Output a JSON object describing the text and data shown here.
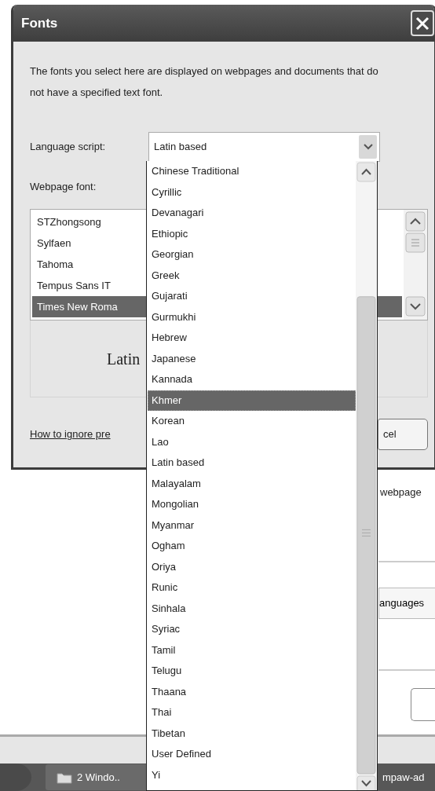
{
  "dialog": {
    "title": "Fonts",
    "description": "The fonts you select here are displayed on webpages and documents that do not have a specified text font.",
    "language_script": {
      "label": "Language script:",
      "value": "Latin based",
      "options": [
        {
          "label": "Chinese Traditional",
          "highlighted": false
        },
        {
          "label": "Cyrillic",
          "highlighted": false
        },
        {
          "label": "Devanagari",
          "highlighted": false
        },
        {
          "label": "Ethiopic",
          "highlighted": false
        },
        {
          "label": "Georgian",
          "highlighted": false
        },
        {
          "label": "Greek",
          "highlighted": false
        },
        {
          "label": "Gujarati",
          "highlighted": false
        },
        {
          "label": "Gurmukhi",
          "highlighted": false
        },
        {
          "label": "Hebrew",
          "highlighted": false
        },
        {
          "label": "Japanese",
          "highlighted": false
        },
        {
          "label": "Kannada",
          "highlighted": false
        },
        {
          "label": "Khmer",
          "highlighted": true
        },
        {
          "label": "Korean",
          "highlighted": false
        },
        {
          "label": "Lao",
          "highlighted": false
        },
        {
          "label": "Latin based",
          "highlighted": false
        },
        {
          "label": "Malayalam",
          "highlighted": false
        },
        {
          "label": "Mongolian",
          "highlighted": false
        },
        {
          "label": "Myanmar",
          "highlighted": false
        },
        {
          "label": "Ogham",
          "highlighted": false
        },
        {
          "label": "Oriya",
          "highlighted": false
        },
        {
          "label": "Runic",
          "highlighted": false
        },
        {
          "label": "Sinhala",
          "highlighted": false
        },
        {
          "label": "Syriac",
          "highlighted": false
        },
        {
          "label": "Tamil",
          "highlighted": false
        },
        {
          "label": "Telugu",
          "highlighted": false
        },
        {
          "label": "Thaana",
          "highlighted": false
        },
        {
          "label": "Thai",
          "highlighted": false
        },
        {
          "label": "Tibetan",
          "highlighted": false
        },
        {
          "label": "User Defined",
          "highlighted": false
        },
        {
          "label": "Yi",
          "highlighted": false
        }
      ]
    },
    "webpage_font": {
      "label": "Webpage font:",
      "fonts": [
        {
          "name": "STZhongsong",
          "selected": false
        },
        {
          "name": "Sylfaen",
          "selected": false
        },
        {
          "name": "Tahoma",
          "selected": false
        },
        {
          "name": "Tempus Sans IT",
          "selected": false
        },
        {
          "name": "Times New Roma",
          "selected": true
        }
      ],
      "preview": "Latin"
    },
    "help_link": "How to ignore pre",
    "buttons": [
      "cel"
    ]
  },
  "background": {
    "text": "webpage",
    "button": "anguages"
  },
  "taskbar": {
    "items": [
      {
        "label": "2 Windo..",
        "kind": "folder"
      },
      {
        "label": "mpaw-ad",
        "kind": "text"
      }
    ]
  }
}
